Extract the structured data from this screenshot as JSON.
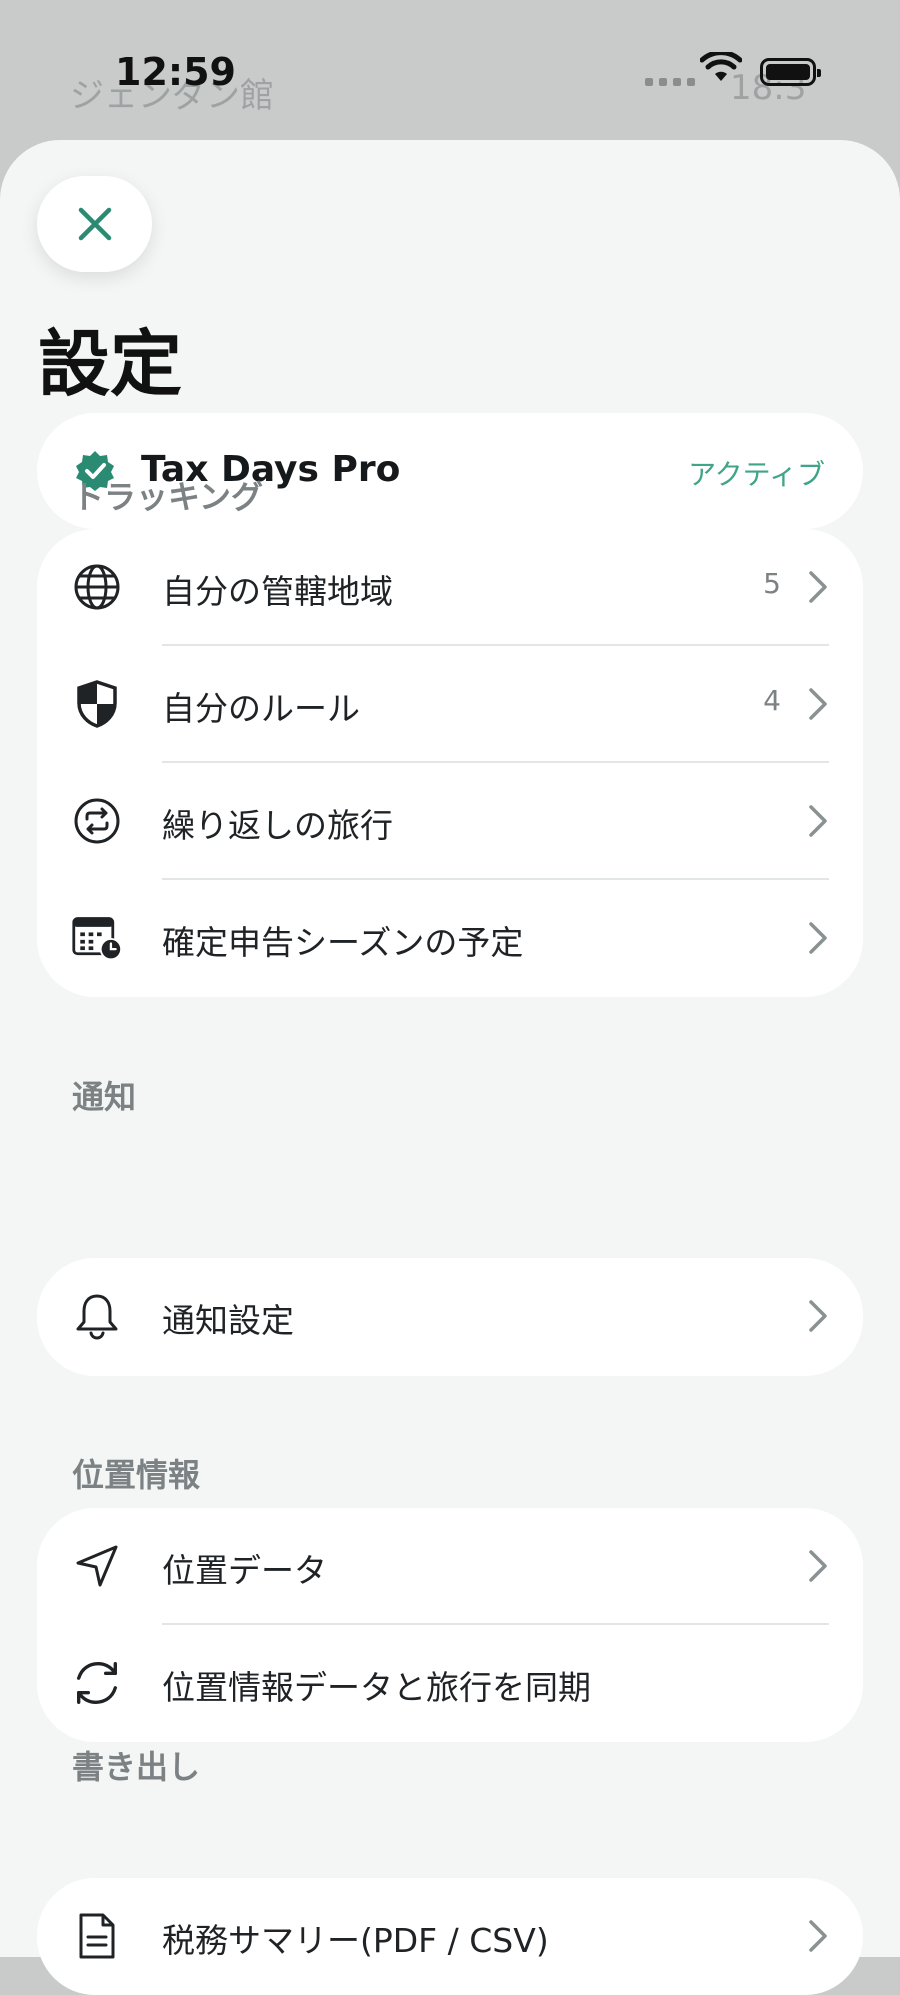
{
  "background_rows": [
    {
      "label": "ジェンダン館",
      "num": "18:3"
    }
  ],
  "status_bar": {
    "time": "12:59"
  },
  "sheet": {
    "title": "設定",
    "pro": {
      "name": "Tax Days Pro",
      "status": "アクティブ"
    },
    "sections": {
      "tracking": {
        "label": "トラッキング",
        "items": [
          {
            "icon": "globe-icon",
            "label": "自分の管轄地域",
            "count": "5"
          },
          {
            "icon": "shield-icon",
            "label": "自分のルール",
            "count": "4"
          },
          {
            "icon": "repeat-icon",
            "label": "繰り返しの旅行"
          },
          {
            "icon": "calendar-clock-icon",
            "label": "確定申告シーズンの予定"
          }
        ]
      },
      "notifications": {
        "label": "通知",
        "items": [
          {
            "icon": "bell-icon",
            "label": "通知設定"
          }
        ]
      },
      "location": {
        "label": "位置情報",
        "items": [
          {
            "icon": "location-arrow-icon",
            "label": "位置データ"
          },
          {
            "icon": "sync-icon",
            "label": "位置情報データと旅行を同期"
          }
        ]
      },
      "export": {
        "label": "書き出し",
        "items": [
          {
            "icon": "document-icon",
            "label": "税務サマリー(PDF / CSV)"
          }
        ]
      }
    }
  },
  "colors": {
    "accent": "#2a8b72",
    "active_text": "#3fa488",
    "sheet_bg": "#f4f6f6"
  }
}
